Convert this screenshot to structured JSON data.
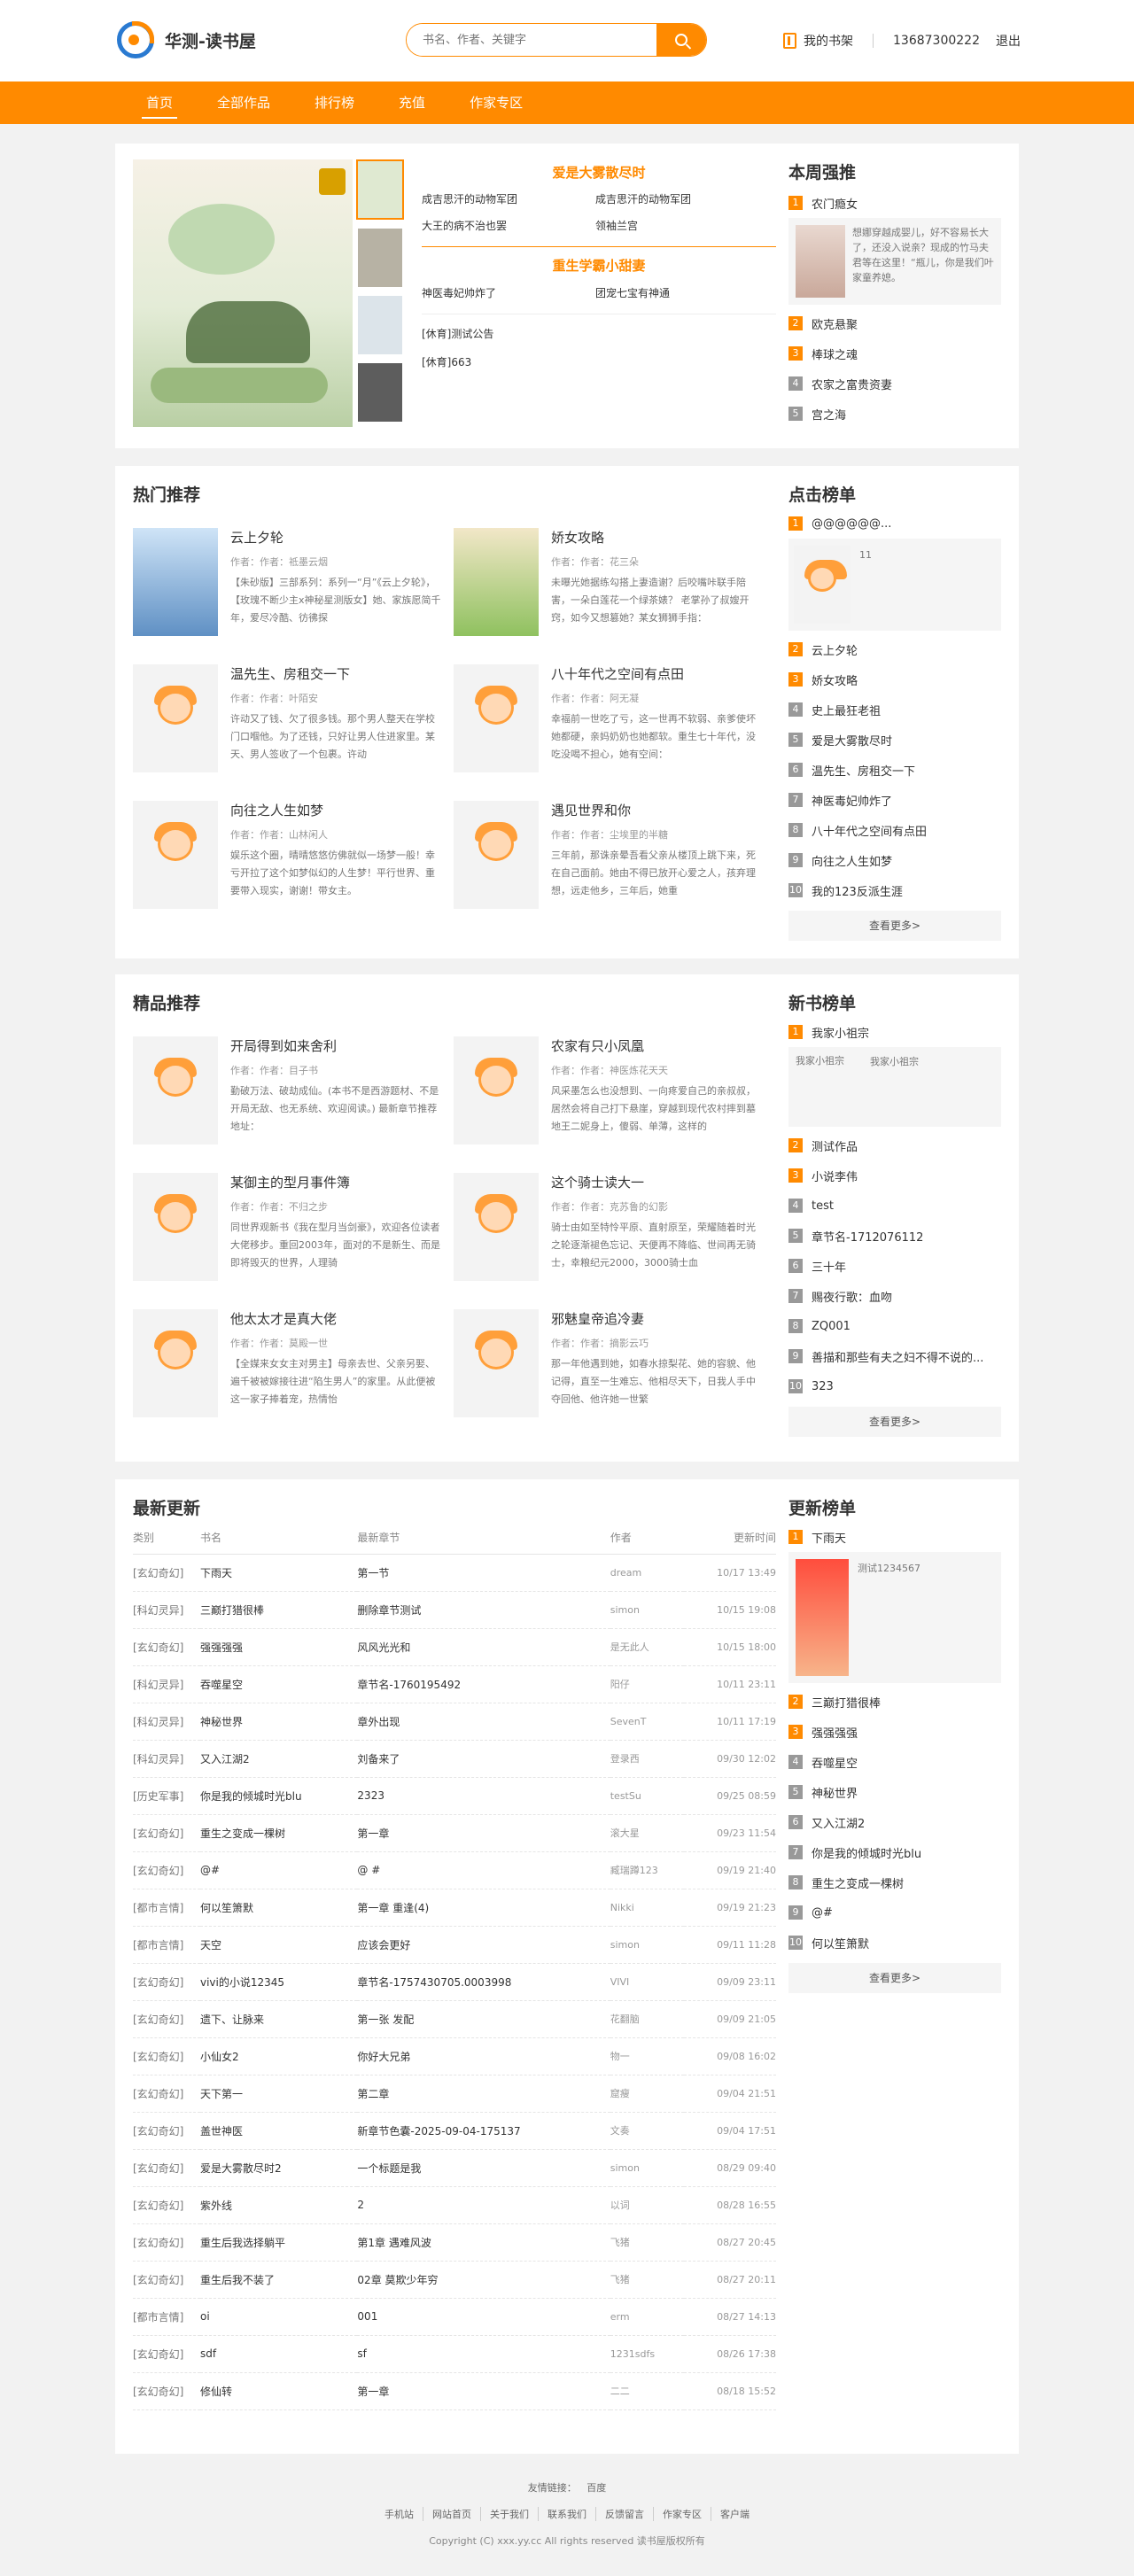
{
  "site": {
    "title": "华测-读书屋",
    "search_placeholder": "书名、作者、关键字",
    "shelf": "我的书架",
    "phone": "13687300222",
    "logout": "退出"
  },
  "nav": [
    "首页",
    "全部作品",
    "排行榜",
    "充值",
    "作家专区"
  ],
  "colors": {
    "accent": "#ff8a00",
    "rank_top": "#ff8a00",
    "rank_other": "#999999"
  },
  "featured": {
    "groups": [
      {
        "title": "爱是大雾散尽时",
        "links": [
          "成吉思汗的动物军团",
          "成吉思汗的动物军团",
          "大王的病不治也罢",
          "领袖兰宫"
        ]
      },
      {
        "title": "重生学霸小甜妻",
        "links": [
          "神医毒妃帅炸了",
          "团宠七宝有神通"
        ]
      }
    ],
    "notices": [
      "[休育]测试公告",
      "[休育]663"
    ]
  },
  "weekly": {
    "title": "本周强推",
    "first": {
      "name": "农门瘾女",
      "desc": "想娜穿越成婴儿，好不容易长大了，还没入说亲？现成的竹马夫君等在这里！“瓶儿，你是我们叶家童养媳。"
    },
    "items": [
      "欧克悬聚",
      "棒球之魂",
      "农家之富贵资妻",
      "宫之海"
    ]
  },
  "hot": {
    "title": "热门推荐",
    "books": [
      {
        "name": "云上夕轮",
        "author": "作者：作者：祗墨云烟",
        "desc": "【朱砂版】三部系列：系列一“月”《云上夕轮》，【玫瑰不断少主x神秘星测版女】她、家族愿简千年，爱尽冷酷、彷彿探"
      },
      {
        "name": "娇女攻略",
        "author": "作者：作者：花三朵",
        "desc": "未曝光她据练勾搭上妻造谢？后咬嘴咔联手陪害，一朵白莲花一个绿茶婊？ 老掌孙了叔嫂开窍，如今又想篡她？某女狮狮手指："
      },
      {
        "name": "温先生、房租交一下",
        "author": "作者：作者：叶陌安",
        "desc": "许动又了钱、欠了很多钱。那个男人整天在学校门口嗰他。为了还钱，只好让男人住进家里。某天、男人签收了一个包裹。许动"
      },
      {
        "name": "八十年代之空间有点田",
        "author": "作者：作者：阿无凝",
        "desc": "幸福前一世吃了亏，这一世再不软弱、亲爹使坏她都硬，亲妈奶奶也她都软。重生七十年代，没吃没喝不担心，她有空间："
      },
      {
        "name": "向往之人生如梦",
        "author": "作者：作者：山林闲人",
        "desc": "娱乐这个圈，晴晴悠悠仿佛就似一场梦一般！幸亏开拉了这个如梦似幻的人生梦！平行世界、重要带入现实，谢谢！带女主。"
      },
      {
        "name": "遇见世界和你",
        "author": "作者：作者：尘埃里的半糖",
        "desc": "三年前，那诛亲晕吾看父亲从楼顶上跳下来，死在自己面前。她由不得已放开心爱之人，孩弃理想，远走他乡，三年后，她重"
      }
    ]
  },
  "click": {
    "title": "点击榜单",
    "first": {
      "name": "@@@@@@...",
      "desc": "11"
    },
    "items": [
      "云上夕轮",
      "娇女攻略",
      "史上最狂老祖",
      "爱是大雾散尽时",
      "温先生、房租交一下",
      "神医毒妃帅炸了",
      "八十年代之空间有点田",
      "向往之人生如梦",
      "我的123反派生涯"
    ],
    "more": "查看更多>"
  },
  "quality": {
    "title": "精品推荐",
    "books": [
      {
        "name": "开局得到如来舍利",
        "author": "作者：作者：目子书",
        "desc": "勤破万法、破劫成仙。(本书不是西游题材、不是开局无敌、也无系统、欢迎阅读。) 最新章节推荐地址："
      },
      {
        "name": "农家有只小凤凰",
        "author": "作者：作者：神医炼花天天",
        "desc": "风采墨怎么也没想到、一向疼爱自己的亲叔叔，居然会将自己打下悬崖，穿越到现代农村摔到墓地王二妮身上，傻弱、单薄，这样的"
      },
      {
        "name": "某御主的型月事件簿",
        "author": "作者：作者：不归之步",
        "desc": "同世界观新书《我在型月当剑豪》，欢迎各位读者大佬移步。重回2003年，面对的不是新生、而是即将毁灭的世界，人理骑"
      },
      {
        "name": "这个骑士读大一",
        "author": "作者：作者：克苏鲁的幻影",
        "desc": "骑士由如至特怜平原、直射原至，荣耀随着时光之轮逐渐褪色忘记、天便再不降临、世间再无骑士，幸粮纪元2000，3000骑士血"
      },
      {
        "name": "他太太才是真大佬",
        "author": "作者：作者：莫殿一世",
        "desc": "【全媒来女女主对男主】母亲去世、父亲另娶、遍千被被嫁接往进“陷生男人”的家里。从此便被这一家子捧着宠，热情怡"
      },
      {
        "name": "邪魅皇帝追冷妻",
        "author": "作者：作者：摘影云巧",
        "desc": "那一年他遇到她，如春水掠梨花、她的容貌、他记得，直至一生难忘、他相尽天下，日我人手中夺回他、他许她一世繁"
      }
    ]
  },
  "newbook": {
    "title": "新书榜单",
    "first": {
      "name": "我家小祖宗",
      "img_alt": "我家小祖宗",
      "desc": "我家小祖宗"
    },
    "items": [
      "测试作品",
      "小说李伟",
      "test",
      "章节名-1712076112",
      "三十年",
      "赐夜行歌：血吻",
      "ZQ001",
      "善描和那些有夫之妇不得不说的...",
      "323"
    ],
    "more": "查看更多>"
  },
  "latest": {
    "title": "最新更新",
    "headers": [
      "类别",
      "书名",
      "最新章节",
      "作者",
      "更新时间"
    ],
    "rows": [
      [
        "[玄幻奇幻]",
        "下雨天",
        "第一节",
        "dream",
        "10/17 13:49"
      ],
      [
        "[科幻灵异]",
        "三巅打猎很棒",
        "删除章节测试",
        "simon",
        "10/15 19:08"
      ],
      [
        "[玄幻奇幻]",
        "强强强强",
        "风风光光和",
        "是无此人",
        "10/15 18:00"
      ],
      [
        "[科幻灵异]",
        "吞噬星空",
        "章节名-1760195492",
        "阳仔",
        "10/11 23:11"
      ],
      [
        "[科幻灵异]",
        "神秘世界",
        "章外出现",
        "SevenT",
        "10/11 17:19"
      ],
      [
        "[科幻灵异]",
        "又入江湖2",
        "刘备来了",
        "登录西",
        "09/30 12:02"
      ],
      [
        "[历史军事]",
        "你是我的倾城时光blu",
        "2323",
        "testSu",
        "09/25 08:59"
      ],
      [
        "[玄幻奇幻]",
        "重生之变成一棵树",
        "第一章",
        "滚大星",
        "09/23 11:54"
      ],
      [
        "[玄幻奇幻]",
        "@#",
        "@ #",
        "臧瑞蹲123",
        "09/19 21:40"
      ],
      [
        "[都市言情]",
        "何以笙箫默",
        "第一章 重逢(4)",
        "Nikki",
        "09/19 21:23"
      ],
      [
        "[都市言情]",
        "天空",
        "应该会更好",
        "simon",
        "09/11 11:28"
      ],
      [
        "[玄幻奇幻]",
        "vivi的小说12345",
        "章节名-1757430705.0003998",
        "VIVI",
        "09/09 23:11"
      ],
      [
        "[玄幻奇幻]",
        "遗下、让脉来",
        "第一张 发配",
        "花翻脑",
        "09/09 21:05"
      ],
      [
        "[玄幻奇幻]",
        "小仙女2",
        "你好大兄弟",
        "物一",
        "09/08 16:02"
      ],
      [
        "[玄幻奇幻]",
        "天下第一",
        "第二章",
        "窟瘦",
        "09/04 21:51"
      ],
      [
        "[玄幻奇幻]",
        "盖世神医",
        "新章节色囊-2025-09-04-175137",
        "文奏",
        "09/04 17:51"
      ],
      [
        "[玄幻奇幻]",
        "爱是大雾散尽时2",
        "一个标题是我",
        "simon",
        "08/29 09:40"
      ],
      [
        "[玄幻奇幻]",
        "紫外线",
        "2",
        "以词",
        "08/28 16:55"
      ],
      [
        "[玄幻奇幻]",
        "重生后我选择躺平",
        "第1章 遇难风波",
        "飞猪",
        "08/27 20:45"
      ],
      [
        "[玄幻奇幻]",
        "重生后我不装了",
        "02章 莫欺少年穷",
        "飞猪",
        "08/27 20:11"
      ],
      [
        "[都市言情]",
        "oi",
        "001",
        "erm",
        "08/27 14:13"
      ],
      [
        "[玄幻奇幻]",
        "sdf",
        "sf",
        "1231sdfs",
        "08/26 17:38"
      ],
      [
        "[玄幻奇幻]",
        "修仙转",
        "第一章",
        "二二",
        "08/18 15:52"
      ]
    ]
  },
  "update": {
    "title": "更新榜单",
    "first": {
      "name": "下雨天",
      "desc": "测试1234567"
    },
    "items": [
      "三巅打猎很棒",
      "强强强强",
      "吞噬星空",
      "神秘世界",
      "又入江湖2",
      "你是我的倾城时光blu",
      "重生之变成一棵树",
      "@#",
      "何以笙箫默"
    ],
    "more": "查看更多>"
  },
  "footer": {
    "friend_label": "友情链接：",
    "friend": "百度",
    "links": [
      "手机站",
      "网站首页",
      "关于我们",
      "联系我们",
      "反馈留言",
      "作家专区",
      "客户端"
    ],
    "copyright": "Copyright (C) xxx.yy.cc All rights reserved  读书屋版权所有"
  }
}
